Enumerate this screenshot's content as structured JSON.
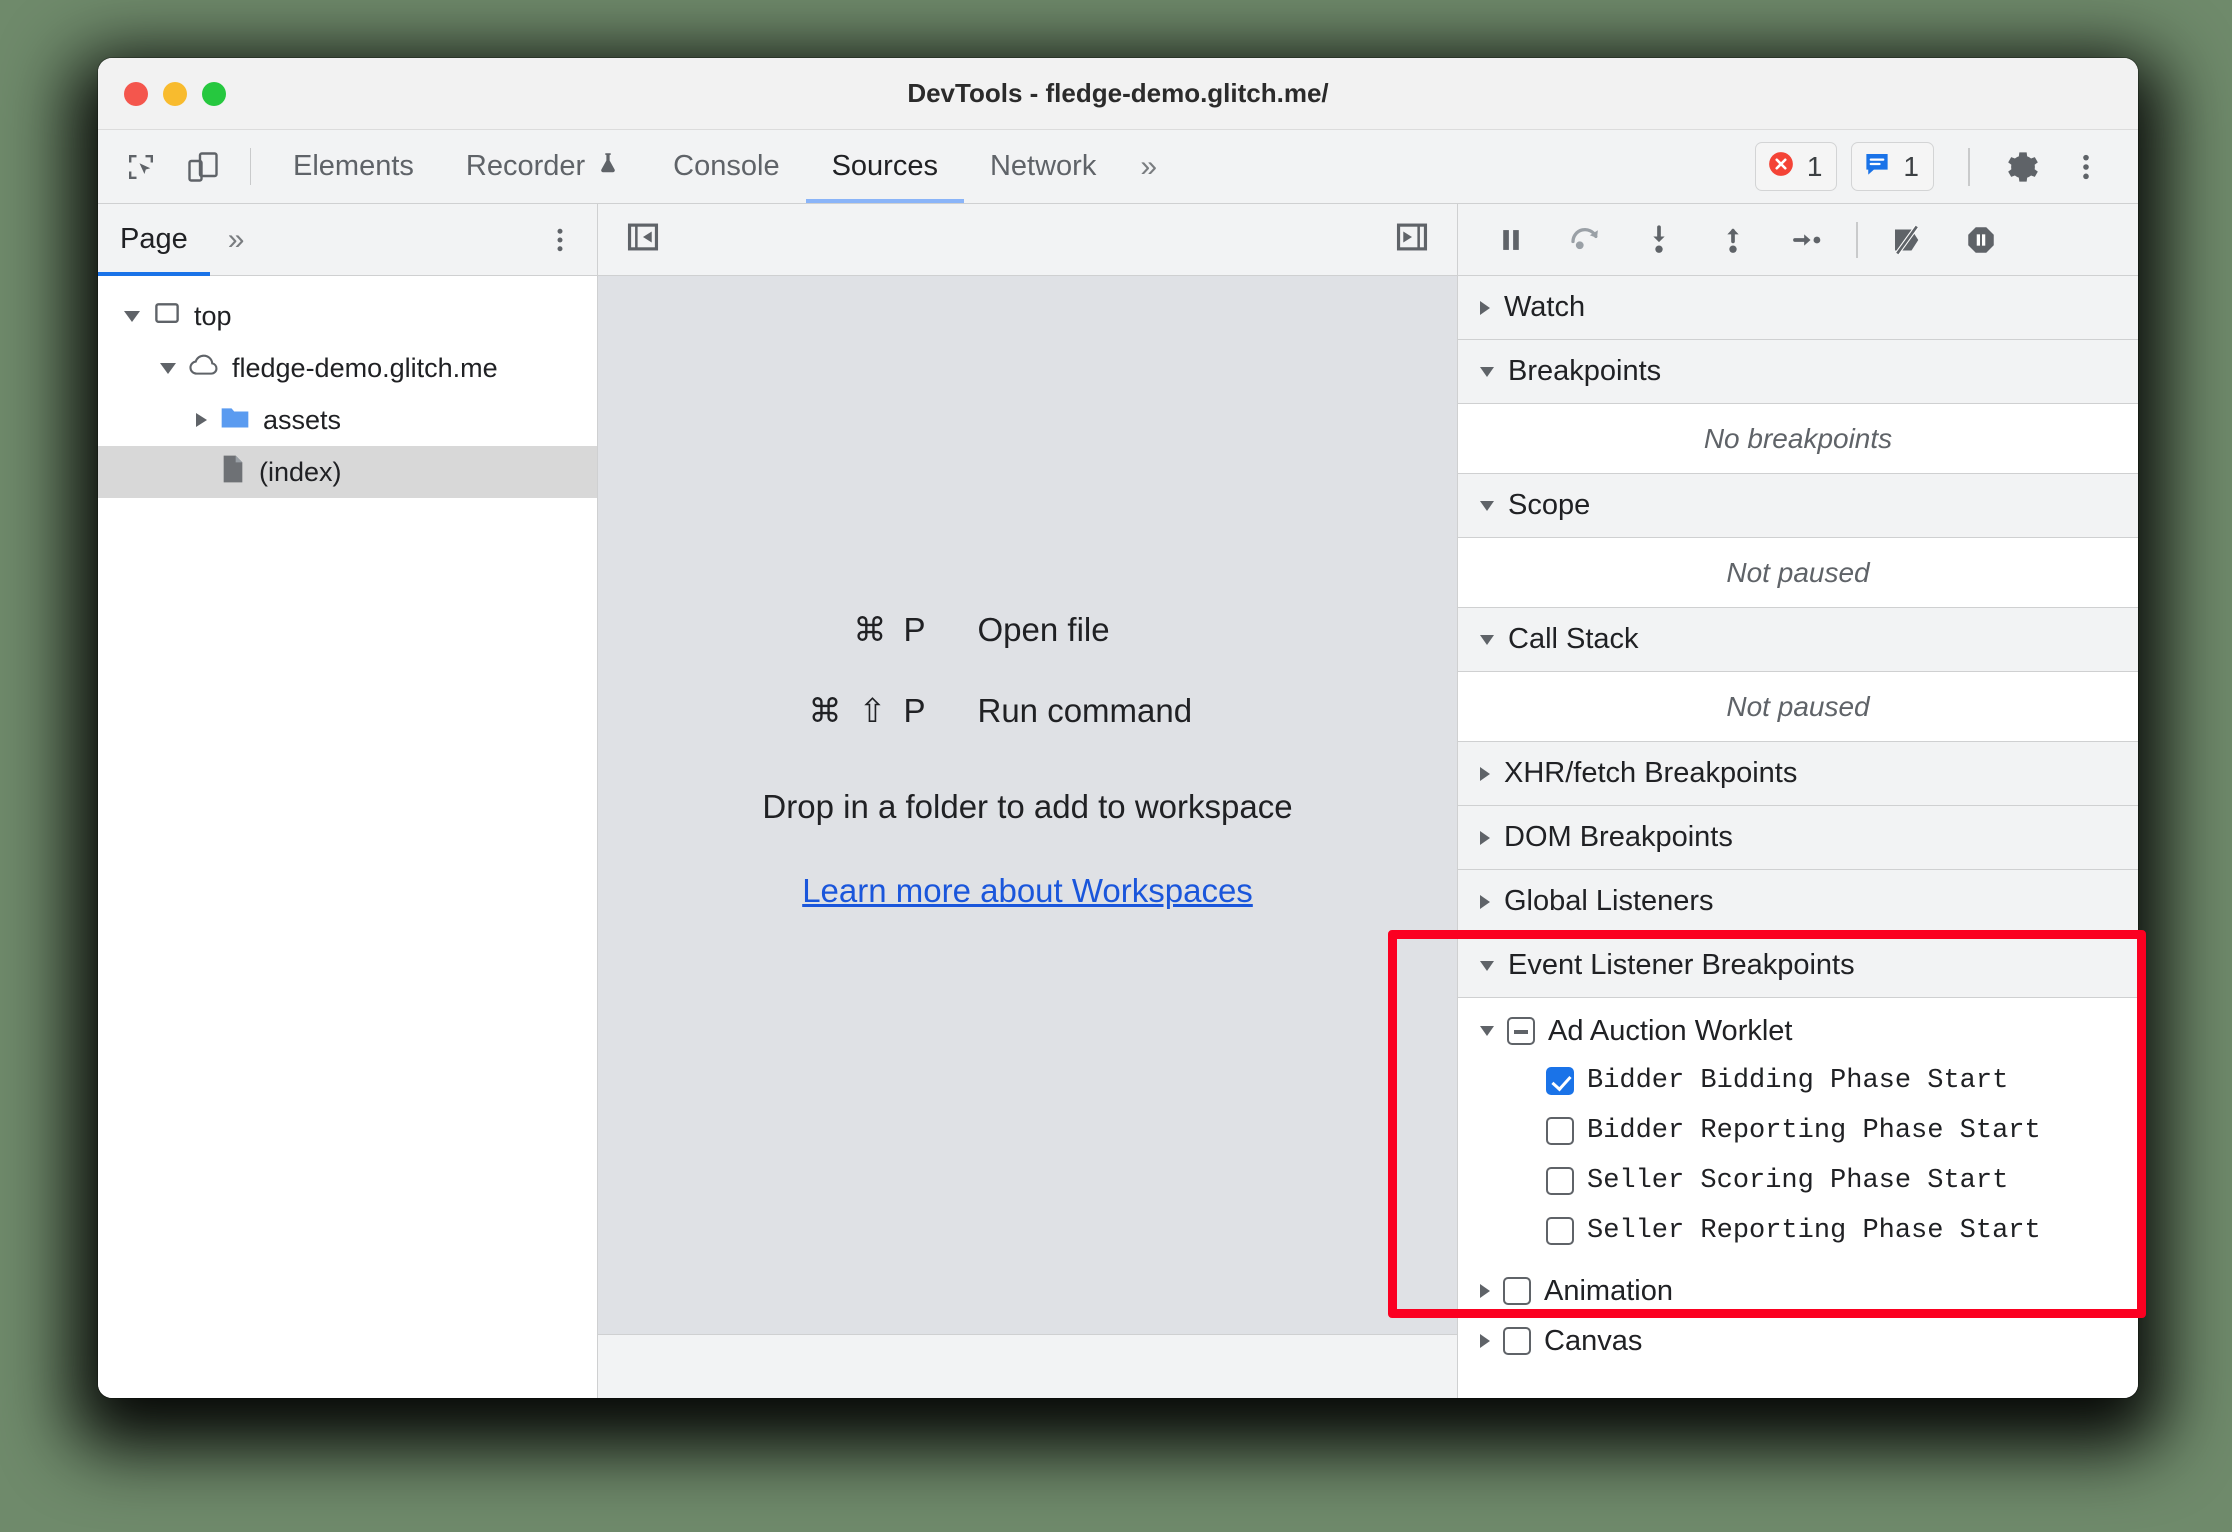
{
  "window": {
    "title": "DevTools - fledge-demo.glitch.me/",
    "traffic_lights": [
      "close",
      "minimize",
      "zoom"
    ]
  },
  "toolbar": {
    "inspect_icon": "inspect-element-icon",
    "device_icon": "device-toolbar-icon",
    "tabs": [
      {
        "label": "Elements",
        "active": false,
        "icon": null
      },
      {
        "label": "Recorder",
        "active": false,
        "icon": "experiment-flask-icon"
      },
      {
        "label": "Console",
        "active": false,
        "icon": null
      },
      {
        "label": "Sources",
        "active": true,
        "icon": null
      },
      {
        "label": "Network",
        "active": false,
        "icon": null
      }
    ],
    "more_tabs_label": "»",
    "errors_count": "1",
    "messages_count": "1",
    "settings_icon": "gear-icon",
    "menu_icon": "kebab-menu-icon"
  },
  "navigator": {
    "tabs": [
      {
        "label": "Page",
        "active": true
      }
    ],
    "more_label": "»",
    "menu_icon": "kebab-menu-icon",
    "tree": [
      {
        "label": "top",
        "icon": "frame-icon",
        "depth": 0,
        "expanded": true,
        "selected": false
      },
      {
        "label": "fledge-demo.glitch.me",
        "icon": "cloud-icon",
        "depth": 1,
        "expanded": true,
        "selected": false
      },
      {
        "label": "assets",
        "icon": "folder-icon",
        "depth": 2,
        "expanded": false,
        "selected": false
      },
      {
        "label": "(index)",
        "icon": "document-icon",
        "depth": 3,
        "expanded": null,
        "selected": true
      }
    ]
  },
  "editor": {
    "collapse_left_icon": "collapse-sidebar-left-icon",
    "collapse_right_icon": "collapse-sidebar-right-icon",
    "shortcuts": [
      {
        "keys": "⌘ P",
        "action": "Open file"
      },
      {
        "keys": "⌘ ⇧ P",
        "action": "Run command"
      }
    ],
    "drop_hint": "Drop in a folder to add to workspace",
    "learn_more_link": "Learn more about Workspaces"
  },
  "debugger": {
    "controls": [
      {
        "name": "pause-script-execution",
        "icon": "pause-icon"
      },
      {
        "name": "step-over-next-function-call",
        "icon": "step-over-icon"
      },
      {
        "name": "step-into-next-function-call",
        "icon": "step-into-icon"
      },
      {
        "name": "step-out-of-current-function",
        "icon": "step-out-icon"
      },
      {
        "name": "step",
        "icon": "step-icon"
      },
      {
        "name": "deactivate-breakpoints",
        "icon": "deactivate-breakpoints-icon"
      },
      {
        "name": "pause-on-exceptions",
        "icon": "pause-on-exceptions-icon"
      }
    ],
    "sections": [
      {
        "title": "Watch",
        "expanded": false,
        "body": null
      },
      {
        "title": "Breakpoints",
        "expanded": true,
        "body": "No breakpoints"
      },
      {
        "title": "Scope",
        "expanded": true,
        "body": "Not paused"
      },
      {
        "title": "Call Stack",
        "expanded": true,
        "body": "Not paused"
      },
      {
        "title": "XHR/fetch Breakpoints",
        "expanded": false,
        "body": null
      },
      {
        "title": "DOM Breakpoints",
        "expanded": false,
        "body": null
      },
      {
        "title": "Global Listeners",
        "expanded": false,
        "body": null
      }
    ],
    "event_listener_breakpoints": {
      "title": "Event Listener Breakpoints",
      "expanded": true,
      "groups": [
        {
          "label": "Ad Auction Worklet",
          "expanded": true,
          "checkbox_state": "indeterminate",
          "children": [
            {
              "label": "Bidder Bidding Phase Start",
              "checked": true
            },
            {
              "label": "Bidder Reporting Phase Start",
              "checked": false
            },
            {
              "label": "Seller Scoring Phase Start",
              "checked": false
            },
            {
              "label": "Seller Reporting Phase Start",
              "checked": false
            }
          ]
        },
        {
          "label": "Animation",
          "expanded": false,
          "checkbox_state": "unchecked",
          "children": []
        },
        {
          "label": "Canvas",
          "expanded": false,
          "checkbox_state": "unchecked",
          "children": []
        }
      ]
    }
  },
  "annotation": {
    "highlight_color": "#fb0021",
    "target": "Event Listener Breakpoints - Ad Auction Worklet"
  }
}
